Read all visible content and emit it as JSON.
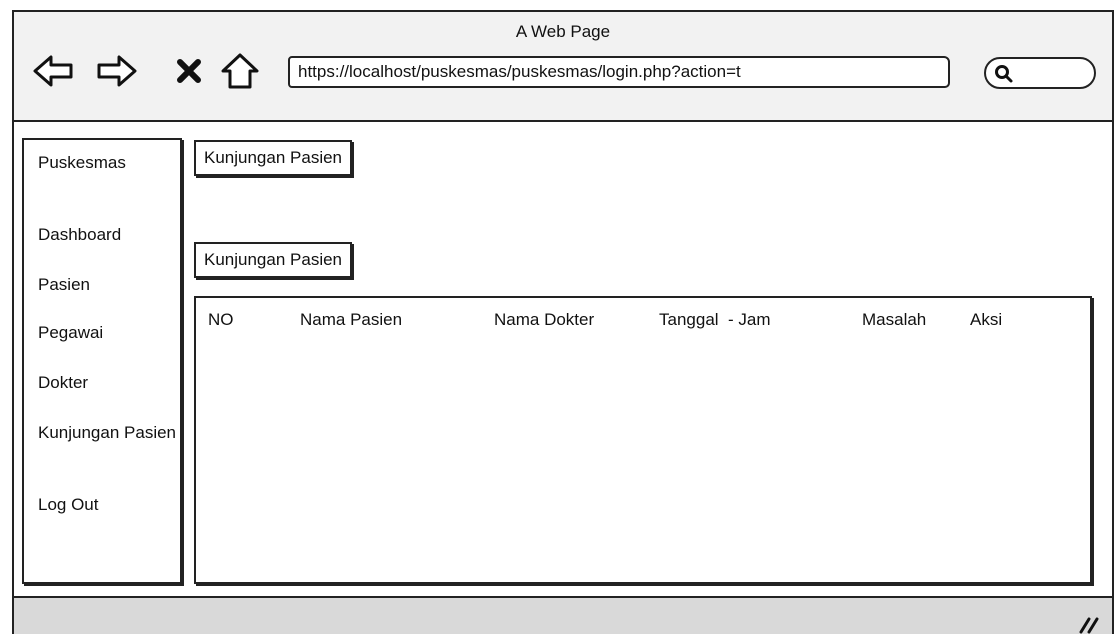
{
  "window": {
    "title": "A Web Page",
    "url": "https://localhost/puskesmas/puskesmas/login.php?action=t",
    "search_value": ""
  },
  "icons": {
    "back": "arrow-left-icon",
    "forward": "arrow-right-icon",
    "stop": "close-icon",
    "home": "home-icon",
    "search": "search-icon",
    "resize": "resize-grip-icon"
  },
  "sidebar": {
    "brand": "Puskesmas",
    "items": [
      {
        "label": "Dashboard"
      },
      {
        "label": "Pasien"
      },
      {
        "label": "Pegawai"
      },
      {
        "label": "Dokter"
      },
      {
        "label": "Kunjungan Pasien"
      },
      {
        "label": "Log Out"
      }
    ]
  },
  "main": {
    "page_title": "Kunjungan Pasien",
    "section_title": "Kunjungan Pasien",
    "table": {
      "columns": [
        "NO",
        "Nama Pasien",
        "Nama Dokter",
        "Tanggal  - Jam",
        "Masalah",
        "Aksi"
      ],
      "rows": []
    }
  }
}
